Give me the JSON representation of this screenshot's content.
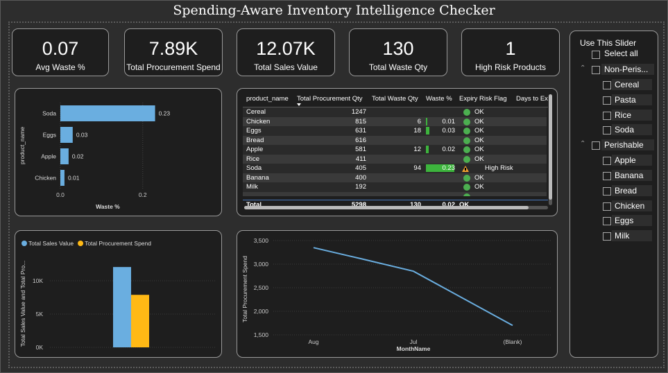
{
  "title": "Spending-Aware Inventory Intelligence Checker",
  "kpis": [
    {
      "value": "0.07",
      "label": "Avg Waste %"
    },
    {
      "value": "7.89K",
      "label": "Total Procurement Spend"
    },
    {
      "value": "12.07K",
      "label": "Total Sales Value"
    },
    {
      "value": "130",
      "label": "Total Waste Qty"
    },
    {
      "value": "1",
      "label": "High Risk Products"
    }
  ],
  "waste_chart": {
    "chart_data": {
      "type": "bar",
      "orientation": "horizontal",
      "categories": [
        "Soda",
        "Eggs",
        "Apple",
        "Chicken"
      ],
      "values": [
        0.23,
        0.03,
        0.02,
        0.01
      ],
      "data_labels": [
        "0.23",
        "0.03",
        "0.02",
        "0.01"
      ],
      "xlabel": "Waste %",
      "ylabel": "product_name",
      "x_ticks": [
        "0.0",
        "0.2"
      ],
      "xlim": [
        0,
        0.32
      ],
      "color": "#6aaee0"
    }
  },
  "table": {
    "headers": [
      "product_name",
      "Total Procurement Qty",
      "Total Waste Qty",
      "Waste %",
      "Expiry Risk Flag",
      "Days to Ex"
    ],
    "rows": [
      {
        "name": "Cereal",
        "proc": "1247",
        "waste": "",
        "pct": "",
        "pct_val": 0,
        "flag": "OK",
        "risk": false
      },
      {
        "name": "Chicken",
        "proc": "815",
        "waste": "6",
        "pct": "0.01",
        "pct_val": 0.01,
        "flag": "OK",
        "risk": false
      },
      {
        "name": "Eggs",
        "proc": "631",
        "waste": "18",
        "pct": "0.03",
        "pct_val": 0.03,
        "flag": "OK",
        "risk": false
      },
      {
        "name": "Bread",
        "proc": "616",
        "waste": "",
        "pct": "",
        "pct_val": 0,
        "flag": "OK",
        "risk": false
      },
      {
        "name": "Apple",
        "proc": "581",
        "waste": "12",
        "pct": "0.02",
        "pct_val": 0.02,
        "flag": "OK",
        "risk": false
      },
      {
        "name": "Rice",
        "proc": "411",
        "waste": "",
        "pct": "",
        "pct_val": 0,
        "flag": "OK",
        "risk": false
      },
      {
        "name": "Soda",
        "proc": "405",
        "waste": "94",
        "pct": "0.23",
        "pct_val": 0.23,
        "flag": "High Risk",
        "risk": true
      },
      {
        "name": "Banana",
        "proc": "400",
        "waste": "",
        "pct": "",
        "pct_val": 0,
        "flag": "OK",
        "risk": false
      },
      {
        "name": "Milk",
        "proc": "192",
        "waste": "",
        "pct": "",
        "pct_val": 0,
        "flag": "OK",
        "risk": false
      }
    ],
    "partial_row_flag": "OK",
    "total": {
      "name": "Total",
      "proc": "5298",
      "waste": "130",
      "pct": "0.02",
      "flag": "OK"
    },
    "colors": {
      "ok": "#4caf50",
      "risk": "#f0a030",
      "bar": "#3db43d"
    }
  },
  "sales_chart": {
    "chart_data": {
      "type": "bar",
      "categories": [
        ""
      ],
      "series": [
        {
          "name": "Total Sales Value",
          "values": [
            12070
          ],
          "color": "#6aaee0"
        },
        {
          "name": "Total Procurement Spend",
          "values": [
            7890
          ],
          "color": "#ffb915"
        }
      ],
      "ylabel": "Total Sales Value and Total Pro...",
      "y_ticks": [
        "0K",
        "5K",
        "10K"
      ],
      "ylim": [
        0,
        13000
      ],
      "legend": "top-left"
    }
  },
  "line_chart": {
    "chart_data": {
      "type": "line",
      "categories": [
        "Aug",
        "Jul",
        "(Blank)"
      ],
      "values": [
        3350,
        2850,
        1700
      ],
      "xlabel": "MonthName",
      "ylabel": "Total Procurement Spend",
      "y_ticks": [
        "1,500",
        "2,000",
        "2,500",
        "3,000",
        "3,500"
      ],
      "ylim": [
        1400,
        3550
      ],
      "color": "#6aaee0"
    }
  },
  "slicer": {
    "title": "Use This Slider",
    "select_all": "Select all",
    "groups": [
      {
        "label": "Non-Peris...",
        "items": [
          "Cereal",
          "Pasta",
          "Rice",
          "Soda"
        ]
      },
      {
        "label": "Perishable",
        "items": [
          "Apple",
          "Banana",
          "Bread",
          "Chicken",
          "Eggs",
          "Milk"
        ]
      }
    ]
  }
}
